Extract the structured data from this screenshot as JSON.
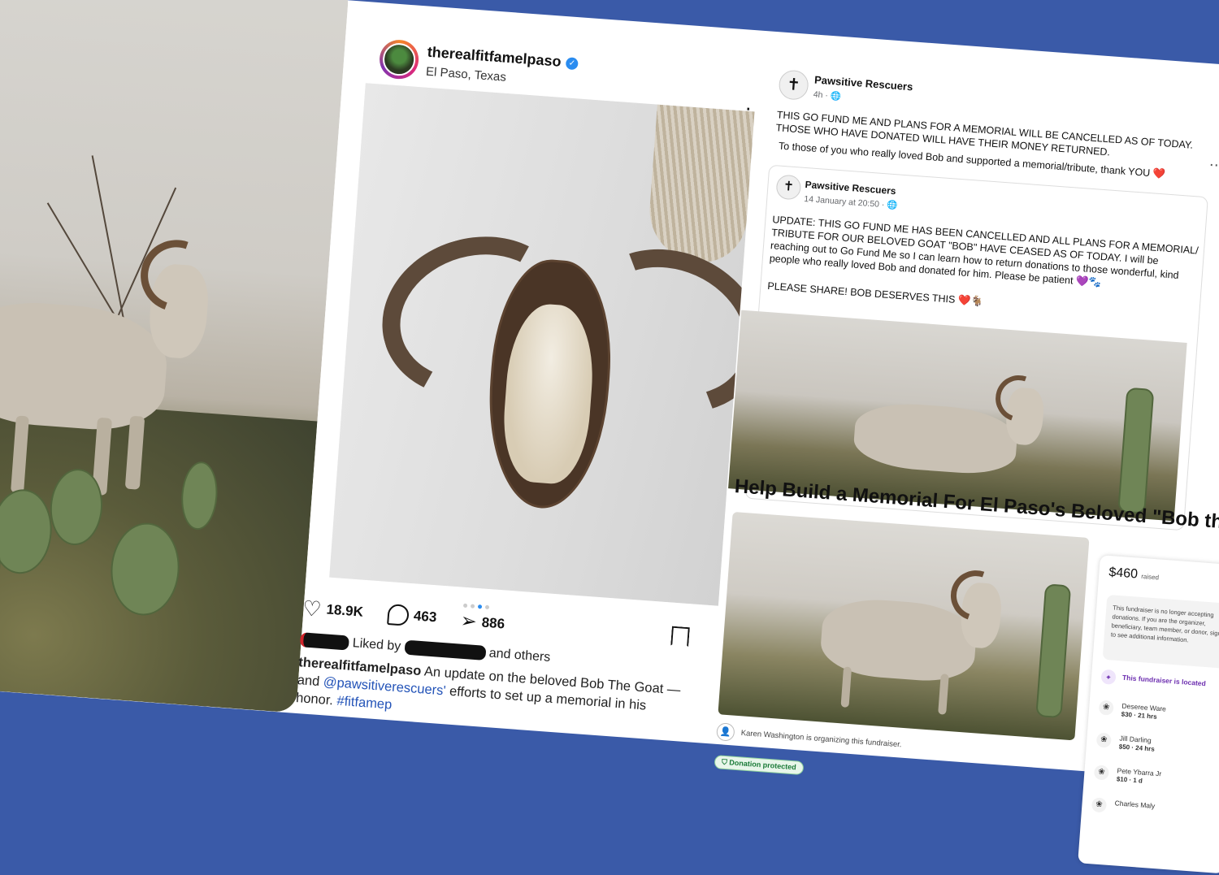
{
  "instagram": {
    "username": "therealfitfamelpaso",
    "location": "El Paso, Texas",
    "likes": "18.9K",
    "comments": "463",
    "shares": "886",
    "liked_by_prefix": "Liked by",
    "liked_by_suffix": "and others",
    "caption_user": "therealfitfamelpaso",
    "caption_text_1": "An update on the beloved Bob The Goat — and",
    "caption_mention": "@pawsitiverescuers'",
    "caption_text_2": "efforts to set up a memorial in his honor.",
    "caption_hashtag": "#fitfamep"
  },
  "facebook": {
    "page_name": "Pawsitive Rescuers",
    "post_time": "4h · 🌐",
    "post_text_1": "THIS GO FUND ME AND PLANS FOR A MEMORIAL WILL BE CANCELLED AS OF TODAY. THOSE WHO HAVE DONATED WILL HAVE THEIR MONEY RETURNED.",
    "post_text_2": "To those of you who really loved Bob and supported a memorial/tribute, thank YOU ❤️",
    "shared_name": "Pawsitive Rescuers",
    "shared_time": "14 January at 20:50 · 🌐",
    "shared_text_1": "UPDATE:  THIS GO FUND ME HAS BEEN CANCELLED AND ALL PLANS FOR A MEMORIAL/ TRIBUTE FOR OUR BELOVED GOAT \"BOB\" HAVE CEASED AS OF TODAY. I will be reaching out to Go Fund Me so I can learn how to return donations to those wonderful, kind people who really loved Bob and donated for him. Please be patient 💜🐾",
    "shared_text_2": "PLEASE SHARE! BOB DESERVES THIS ❤️🐐"
  },
  "gofundme": {
    "title": "Help Build a Memorial For El Paso's Beloved \"Bob the Go",
    "organizer_text": "Karen Washington is organizing this fundraiser.",
    "protected_label": "Donation protected",
    "raised_amount": "$460",
    "raised_label": "raised",
    "notice_text": "This fundraiser is no longer accepting donations. If you are the organizer, beneficiary, team member, or donor, sign in to see additional information.",
    "located_text": "This fundraiser is located",
    "donations": [
      {
        "name": "Deseree Ware",
        "detail": "$30 · 21 hrs"
      },
      {
        "name": "Jill Darling",
        "detail": "$50 · 24 hrs"
      },
      {
        "name": "Pete Ybarra Jr",
        "detail": "$10 · 1 d"
      },
      {
        "name": "Charles Maly",
        "detail": ""
      }
    ]
  }
}
